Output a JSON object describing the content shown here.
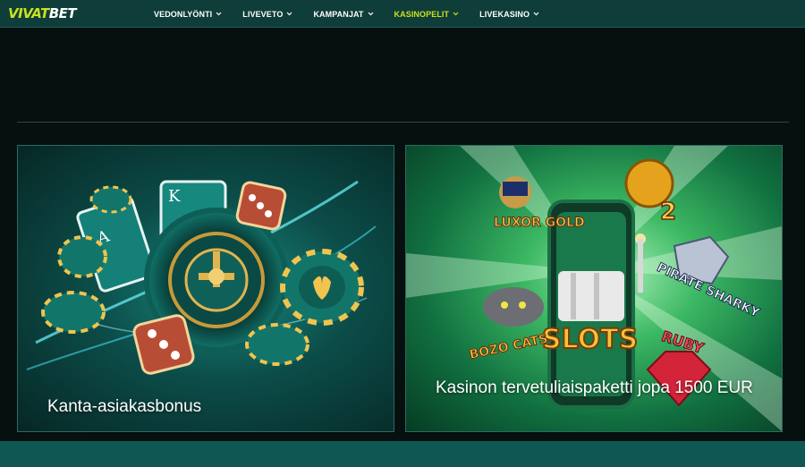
{
  "header": {
    "logo_a": "VIVAT",
    "logo_b": "BET",
    "nav": [
      {
        "label": "VEDONLYÖNTI"
      },
      {
        "label": "LIVEVETO"
      },
      {
        "label": "KAMPANJAT"
      },
      {
        "label": "KASINOPELIT"
      },
      {
        "label": "LIVEKASINO"
      }
    ]
  },
  "colors": {
    "accent": "#c8e21d",
    "header_bg": "#0f3d39",
    "page_bg": "#05100f"
  },
  "promos": [
    {
      "title": "Kanta-asiakasbonus",
      "art_text": {
        "card_letter_1": "K",
        "card_letter_2": "A"
      }
    },
    {
      "title": "Kasinon tervetuliaispaketti jopa 1500 EUR",
      "art_text": {
        "slots": "SLOTS",
        "game_1": "LUXOR GOLD",
        "game_2": "BOZO CATS",
        "game_3": "PIRATE SHARKY",
        "game_4": "RUBY",
        "game_5": "2"
      }
    }
  ]
}
